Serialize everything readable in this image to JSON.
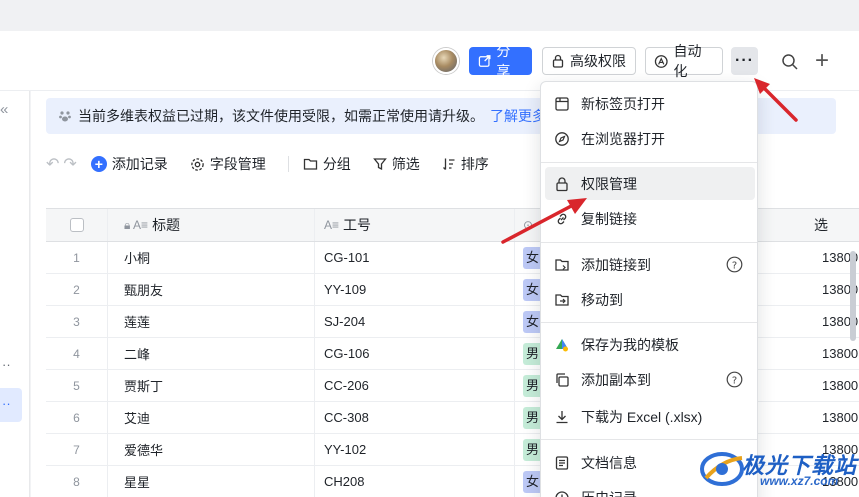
{
  "header": {
    "share_label": "分享",
    "advanced_perm_label": "高级权限",
    "automation_label": "自动化",
    "more_label": "···"
  },
  "banner": {
    "text": "当前多维表权益已过期，该文件使用受限，如需正常使用请升级。",
    "link": "了解更多"
  },
  "toolbar": {
    "add_record": "添加记录",
    "field_manage": "字段管理",
    "group": "分组",
    "filter": "筛选",
    "sort": "排序"
  },
  "table": {
    "columns": {
      "title": "标题",
      "no": "工号",
      "tel": "选"
    },
    "rows": [
      {
        "num": "1",
        "title": "小桐",
        "no": "CG-101",
        "tag": "女",
        "tag_type": "f",
        "tel": "13800"
      },
      {
        "num": "2",
        "title": "甄朋友",
        "no": "YY-109",
        "tag": "女",
        "tag_type": "f",
        "tel": "13800"
      },
      {
        "num": "3",
        "title": "莲莲",
        "no": "SJ-204",
        "tag": "女",
        "tag_type": "f",
        "tel": "13800"
      },
      {
        "num": "4",
        "title": "二峰",
        "no": "CG-106",
        "tag": "男",
        "tag_type": "m",
        "tel": "13800"
      },
      {
        "num": "5",
        "title": "贾斯丁",
        "no": "CC-206",
        "tag": "男",
        "tag_type": "m",
        "tel": "13800"
      },
      {
        "num": "6",
        "title": "艾迪",
        "no": "CC-308",
        "tag": "男",
        "tag_type": "m",
        "tel": "13800"
      },
      {
        "num": "7",
        "title": "爱德华",
        "no": "YY-102",
        "tag": "男",
        "tag_type": "m",
        "tel": "13800"
      },
      {
        "num": "8",
        "title": "星星",
        "no": "CH208",
        "tag": "女",
        "tag_type": "f",
        "tel": "13800"
      }
    ]
  },
  "menu": {
    "items": [
      {
        "label": "新标签页打开",
        "icon": "new-tab-icon"
      },
      {
        "label": "在浏览器打开",
        "icon": "compass-icon"
      },
      {
        "label": "权限管理",
        "icon": "lock-icon"
      },
      {
        "label": "复制链接",
        "icon": "link-icon"
      },
      {
        "label": "添加链接到",
        "icon": "folder-link-icon"
      },
      {
        "label": "移动到",
        "icon": "folder-move-icon"
      },
      {
        "label": "保存为我的模板",
        "icon": "template-icon"
      },
      {
        "label": "添加副本到",
        "icon": "copy-icon"
      },
      {
        "label": "下载为 Excel (.xlsx)",
        "icon": "download-icon"
      },
      {
        "label": "文档信息",
        "icon": "doc-info-icon"
      },
      {
        "label": "历史记录",
        "icon": "history-icon"
      }
    ]
  },
  "watermark": {
    "brand": "极光下载站",
    "url": "www.xz7.com"
  },
  "colors": {
    "accent": "#3370ff",
    "arrow": "#d9262c",
    "tag_female": "#bdc9f6",
    "tag_male": "#c5ecd8"
  }
}
